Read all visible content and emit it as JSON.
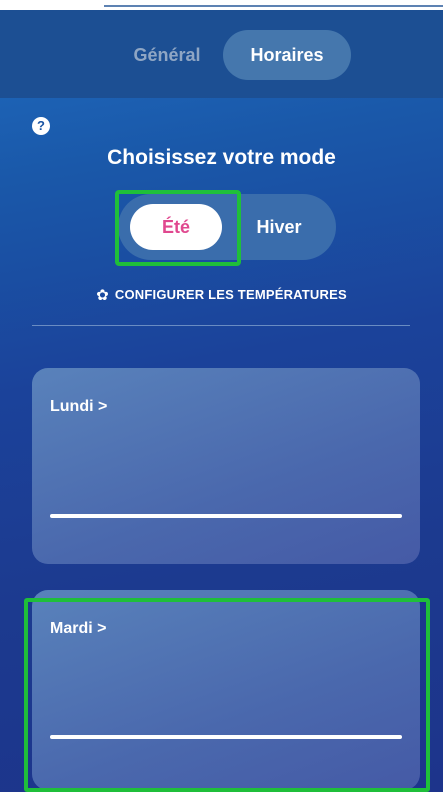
{
  "tabs": {
    "general_label": "Général",
    "horaires_label": "Horaires",
    "active": "Horaires"
  },
  "help": {
    "glyph": "?"
  },
  "mode": {
    "title": "Choisissez votre mode",
    "options": [
      "Été",
      "Hiver"
    ],
    "selected": "Été",
    "ete_label": "Été",
    "hiver_label": "Hiver"
  },
  "configure": {
    "icon": "gear-icon",
    "label": "CONFIGURER LES TEMPÉRATURES"
  },
  "days": [
    {
      "label": "Lundi >"
    },
    {
      "label": "Mardi >"
    }
  ],
  "colors": {
    "highlight": "#1fbf3a",
    "ete_text": "#e0488f",
    "background": "#1c3a8f"
  }
}
